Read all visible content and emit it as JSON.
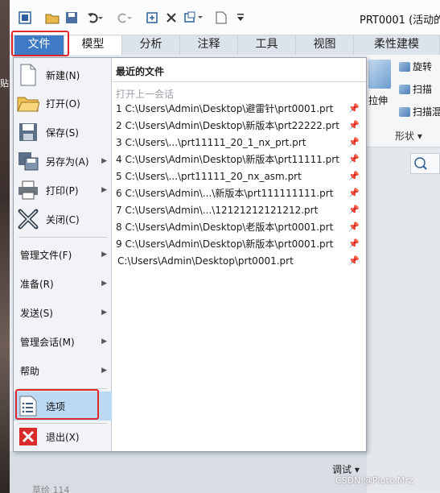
{
  "desktop_char": "贴",
  "window": {
    "title": "PRT0001 (活动的"
  },
  "tabs": [
    "文件",
    "模型",
    "分析",
    "注释",
    "工具",
    "视图",
    "柔性建模"
  ],
  "ribbon_right": {
    "revolve": "旋转",
    "sweep": "扫描",
    "swept_blend": "扫描混",
    "extrude": "拉伸",
    "group": "形状"
  },
  "menu": {
    "new": "新建(N)",
    "open": "打开(O)",
    "save": "保存(S)",
    "save_as": "另存为(A)",
    "print": "打印(P)",
    "close": "关闭(C)",
    "manage_file": "管理文件(F)",
    "prepare": "准备(R)",
    "send": "发送(S)",
    "manage_session": "管理会话(M)",
    "help": "帮助",
    "options": "选项",
    "exit": "退出(X)"
  },
  "recent": {
    "title": "最近的文件",
    "open_last": "打开上一会话",
    "files": [
      "1 C:\\Users\\Admin\\Desktop\\避雷针\\prt0001.prt",
      "2 C:\\Users\\Admin\\Desktop\\新版本\\prt22222.prt",
      "3 C:\\Users\\...\\prt11111_20_1_nx_prt.prt",
      "4 C:\\Users\\Admin\\Desktop\\新版本\\prt11111.prt",
      "5 C:\\Users\\...\\prt11111_20_nx_asm.prt",
      "6 C:\\Users\\Admin\\...\\新版本\\prt111111111.prt",
      "7 C:\\Users\\Admin\\...\\12121212121212.prt",
      "8 C:\\Users\\Admin\\Desktop\\老版本\\prt0001.prt",
      "9 C:\\Users\\Admin\\Desktop\\新版本\\prt0001.prt",
      "C:\\Users\\Admin\\Desktop\\prt0001.prt"
    ]
  },
  "debug": "调试 ▾",
  "bottom_item": "草绘 114",
  "watermark": "CSDN @Pluto.Mrz"
}
